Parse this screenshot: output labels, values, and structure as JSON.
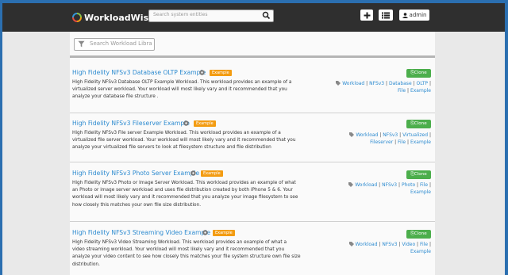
{
  "brand": {
    "name": "WorkloadWisdom",
    "tm": "™"
  },
  "nav": {
    "search_placeholder": "Search system entities",
    "user_label": "admin"
  },
  "library_search": {
    "placeholder": "Search Workload Library"
  },
  "colors": {
    "accent": "#2d8bd0",
    "badge": "#f39c12",
    "clone": "#4cae4c",
    "nav": "#2f2f2f"
  },
  "items": [
    {
      "title": "High Fidelity NFSv3 Database OLTP Example",
      "badge": "Example",
      "desc_lines": [
        "High Fidelity NFSv3 Database OLTP Example Workload. This workload provides an example of a",
        "virtualized server workload. Your workload will most likely vary and it recommended that you",
        "analyze your database file structure ."
      ],
      "tags": [
        "Workload",
        "NFSv3",
        "Database",
        "OLTP",
        "File",
        "Example"
      ],
      "clone": "Clone"
    },
    {
      "title": "High Fidelity NFSv3 Fileserver Example",
      "badge": "Example",
      "desc_lines": [
        "High Fidelity NFSv3 File server Example Workload. This workload provides an example of a",
        "virtualized file server workload. Your workload will most likely vary and it recommended that you",
        "analyze your virtualized file servers to look at filesystem structure and file distribution"
      ],
      "tags": [
        "Workload",
        "NFSv3",
        "Virtualized",
        "Fileserver",
        "File",
        "Example"
      ],
      "clone": "Clone"
    },
    {
      "title": "High Fidelity NFSv3 Photo Server Example",
      "badge": "Example",
      "desc_lines": [
        "High Fidelity NFSv3 Photo or Image Server Workload. This workload provides an example of what",
        "an Photo or image server workload and uses file distribution created by both iPhone 5 & 6. Your",
        "workload will most likely vary and it recommended that you analyze your image filesystem to see",
        "how closely this matches your own file size distribution."
      ],
      "tags": [
        "Workload",
        "NFSv3",
        "Photo",
        "File",
        "Example"
      ],
      "clone": "Clone"
    },
    {
      "title": "High Fidelity NFSv3 Streaming Video Example",
      "badge": "Example",
      "desc_lines": [
        "High Fidelity NFSv3 Video Streaming Workload. This workload provides an example of what a",
        "video streaming workload. Your workload will most likely vary and it recommended that you",
        "analyze your video content to see how closely this matches your file system structure own file size",
        "distribution."
      ],
      "tags": [
        "Workload",
        "NFSv3",
        "Video",
        "File",
        "Example"
      ],
      "clone": "Clone"
    }
  ]
}
